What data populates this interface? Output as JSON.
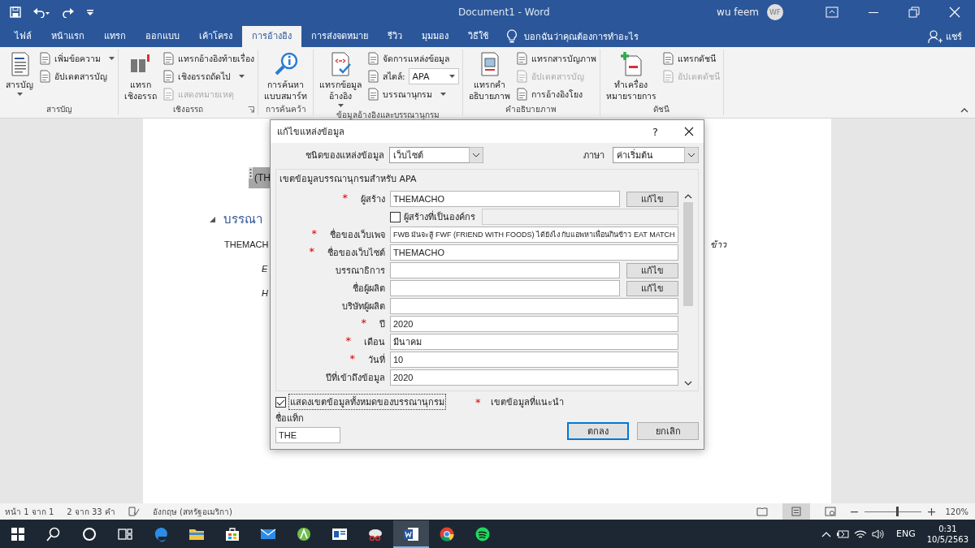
{
  "window": {
    "title": "Document1  -  Word",
    "user": "wu feem",
    "avatar": "WF"
  },
  "tabs": [
    {
      "label": "ไฟล์",
      "selected": false
    },
    {
      "label": "หน้าแรก",
      "selected": false
    },
    {
      "label": "แทรก",
      "selected": false
    },
    {
      "label": "ออกแบบ",
      "selected": false
    },
    {
      "label": "เค้าโครง",
      "selected": false
    },
    {
      "label": "การอ้างอิง",
      "selected": true
    },
    {
      "label": "การส่งจดหมาย",
      "selected": false
    },
    {
      "label": "รีวิว",
      "selected": false
    },
    {
      "label": "มุมมอง",
      "selected": false
    },
    {
      "label": "วิธีใช้",
      "selected": false
    }
  ],
  "tell_me": {
    "placeholder": "บอกฉันว่าคุณต้องการทำอะไร"
  },
  "share": "แชร์",
  "ribbon": {
    "groups": [
      {
        "label": "สารบัญ",
        "launcher": false,
        "items": [
          {
            "kind": "large",
            "label": "สารบัญ",
            "dropdown": true,
            "disabled": false
          },
          {
            "kind": "small",
            "label": "เพิ่มข้อความ",
            "dropdown": true,
            "disabled": false
          },
          {
            "kind": "small",
            "label": "อัปเดตสารบัญ",
            "dropdown": false,
            "disabled": false
          }
        ]
      },
      {
        "label": "เชิงอรรถ",
        "launcher": true,
        "items": [
          {
            "kind": "large",
            "label": "แทรก\nเชิงอรรถ",
            "dropdown": false,
            "disabled": false
          },
          {
            "kind": "small",
            "label": "แทรกอ้างอิงท้ายเรื่อง",
            "dropdown": false,
            "disabled": false
          },
          {
            "kind": "small",
            "label": "เชิงอรรถถัดไป",
            "dropdown": true,
            "disabled": false
          },
          {
            "kind": "small",
            "label": "แสดงหมายเหตุ",
            "dropdown": false,
            "disabled": true
          }
        ]
      },
      {
        "label": "การค้นคว้า",
        "launcher": false,
        "items": [
          {
            "kind": "large",
            "label": "การค้นหา\nแบบสมาร์ท",
            "dropdown": false,
            "disabled": false
          }
        ]
      },
      {
        "label": "ข้อมูลอ้างอิงและบรรณานุกรม",
        "launcher": false,
        "items": [
          {
            "kind": "large",
            "label": "แทรกข้อมูล\nอ้างอิง",
            "dropdown": true,
            "disabled": false
          },
          {
            "kind": "small",
            "label": "จัดการแหล่งข้อมูล",
            "dropdown": false,
            "disabled": false
          },
          {
            "kind": "style",
            "label": "สไตล์:",
            "value": "APA",
            "dropdown": true,
            "disabled": false
          },
          {
            "kind": "small",
            "label": "บรรณานุกรม",
            "dropdown": true,
            "disabled": false
          }
        ]
      },
      {
        "label": "คำอธิบายภาพ",
        "launcher": false,
        "items": [
          {
            "kind": "large",
            "label": "แทรกคำ\nอธิบายภาพ",
            "dropdown": false,
            "disabled": false
          },
          {
            "kind": "small",
            "label": "แทรกสารบัญภาพ",
            "dropdown": false,
            "disabled": false
          },
          {
            "kind": "small",
            "label": "อัปเดตสารบัญ",
            "dropdown": false,
            "disabled": true
          },
          {
            "kind": "small",
            "label": "การอ้างอิงโยง",
            "dropdown": false,
            "disabled": false
          }
        ]
      },
      {
        "label": "ดัชนี",
        "launcher": false,
        "items": [
          {
            "kind": "large",
            "label": "ทำเครื่อง\nหมายรายการ",
            "dropdown": false,
            "disabled": false
          },
          {
            "kind": "small",
            "label": "แทรกดัชนี",
            "dropdown": false,
            "disabled": false
          },
          {
            "kind": "small",
            "label": "อัปเดตดัชนี",
            "dropdown": false,
            "disabled": true
          }
        ]
      }
    ]
  },
  "document": {
    "citation": "(TH",
    "heading": "บรรณา",
    "entries": [
      "THEMACH",
      "E",
      "H"
    ],
    "overflow_text": "ข้าว"
  },
  "dialog": {
    "title": "แก้ไขแหล่งข้อมูล",
    "help": "?",
    "source_type": {
      "label": "ชนิดของแหล่งข้อมูล",
      "value": "เว็บไซต์"
    },
    "language": {
      "label": "ภาษา",
      "value": "ค่าเริ่มต้น"
    },
    "group_label": "เขตข้อมูลบรรณานุกรมสำหรับ APA",
    "fields": [
      {
        "kind": "text",
        "label": "ผู้สร้าง",
        "required": true,
        "value": "THEMACHO",
        "button": "แก้ไข"
      },
      {
        "kind": "checkbox",
        "label": "ผู้สร้างที่เป็นองค์กร",
        "checked": false
      },
      {
        "kind": "text",
        "label": "ชื่อของเว็บเพจ",
        "required": true,
        "value": "FWB มันจะสู้ FWF (FRIEND WITH FOODS) ได้ยังไง กับแอพหาเพื่อนกินข้าว EAT MATCH"
      },
      {
        "kind": "text",
        "label": "ชื่อของเว็บไซต์",
        "required": true,
        "value": "THEMACHO"
      },
      {
        "kind": "text",
        "label": "บรรณาธิการ",
        "required": false,
        "button": "แก้ไข"
      },
      {
        "kind": "text",
        "label": "ชื่อผู้ผลิต",
        "required": false,
        "button": "แก้ไข"
      },
      {
        "kind": "text",
        "label": "บริษัทผู้ผลิต",
        "required": false
      },
      {
        "kind": "text",
        "label": "ปี",
        "required": true,
        "value": "2020"
      },
      {
        "kind": "text",
        "label": "เดือน",
        "required": true,
        "value": "มีนาคม"
      },
      {
        "kind": "text",
        "label": "วันที่",
        "required": true,
        "value": "10"
      },
      {
        "kind": "text",
        "label": "ปีที่เข้าถึงข้อมูล",
        "required": false,
        "value": "2020"
      }
    ],
    "show_all": {
      "label": "แสดงเขตข้อมูลทั้งหมดของบรรณานุกรม",
      "checked": true
    },
    "legend": {
      "mark": "*",
      "label": "เขตข้อมูลที่แนะนำ"
    },
    "tag": {
      "label": "ชื่อแท็ก",
      "value": "THE"
    },
    "buttons": [
      {
        "label": "ตกลง",
        "default": true
      },
      {
        "label": "ยกเลิก",
        "default": false
      }
    ]
  },
  "status_bar": {
    "page": "หน้า 1 จาก 1",
    "words": "2 จาก 33 คำ",
    "language": "อังกฤษ (สหรัฐอเมริกา)",
    "zoom": {
      "level": 0.55,
      "reading": "120%"
    }
  },
  "taskbar": {
    "apps": [
      {
        "kind": "start",
        "selected": false
      },
      {
        "kind": "search",
        "selected": false
      },
      {
        "kind": "cortana",
        "selected": false
      },
      {
        "kind": "taskview",
        "selected": false
      },
      {
        "kind": "edge",
        "selected": false
      },
      {
        "kind": "explorer",
        "selected": false
      },
      {
        "kind": "store",
        "selected": false
      },
      {
        "kind": "mail",
        "selected": false
      },
      {
        "kind": "android",
        "selected": false
      },
      {
        "kind": "reader",
        "selected": false
      },
      {
        "kind": "snip",
        "selected": false
      },
      {
        "kind": "word",
        "selected": true
      },
      {
        "kind": "chrome",
        "selected": false
      },
      {
        "kind": "spotify",
        "selected": false
      }
    ],
    "language": "ENG",
    "time": "0:31",
    "date": "10/5/2563"
  }
}
